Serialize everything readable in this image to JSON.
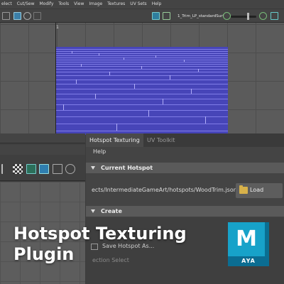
{
  "menubar": {
    "items": [
      "elect",
      "Cut/Sew",
      "Modify",
      "Tools",
      "View",
      "Image",
      "Textures",
      "UV Sets",
      "Help"
    ]
  },
  "toolbar": {
    "uv_set_label": "1_Trim_LP_standardSurf"
  },
  "uv_editor": {
    "tick_label": "1"
  },
  "panel": {
    "tabs": [
      "Hotspot Texturing",
      "UV Toolkit"
    ],
    "help_label": "Help",
    "current_hotspot_header": "Current Hotspot",
    "path": "ects/IntermediateGameArt/hotspots/WoodTrim.json",
    "load_label": "Load",
    "create_header": "Create",
    "save_label": "Save Hotspot As...",
    "faint_label": "ection Select"
  },
  "overlay": {
    "title_line1": "Hotspot Texturing",
    "title_line2": "Plugin"
  },
  "badge": {
    "letter": "M",
    "text": "AYA"
  },
  "colors": {
    "accent": "#17a2c9",
    "uv_tile": "#4745b8",
    "panel_bg": "#444444"
  }
}
